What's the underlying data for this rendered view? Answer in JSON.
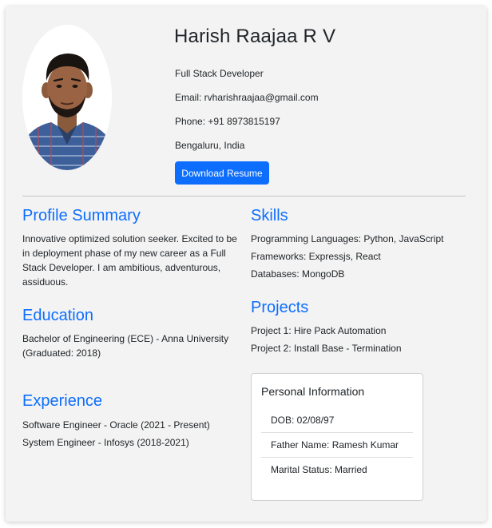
{
  "header": {
    "name": "Harish Raajaa R V",
    "role": "Full Stack Developer",
    "email": "Email: rvharishraajaa@gmail.com",
    "phone": "Phone: +91 8973815197",
    "location": "Bengaluru, India",
    "download_label": "Download Resume"
  },
  "profile_summary": {
    "title": "Profile Summary",
    "text": "Innovative optimized solution seeker. Excited to be in deployment phase of my new career as a Full Stack Developer. I am ambitious, adventurous, assiduous."
  },
  "education": {
    "title": "Education",
    "text": "Bachelor of Engineering (ECE) - Anna University (Graduated: 2018)"
  },
  "experience": {
    "title": "Experience",
    "items": [
      "Software Engineer - Oracle (2021 - Present)",
      "System Engineer - Infosys (2018-2021)"
    ]
  },
  "skills": {
    "title": "Skills",
    "items": [
      "Programming Languages: Python, JavaScript",
      "Frameworks: Expressjs, React",
      "Databases: MongoDB"
    ]
  },
  "projects": {
    "title": "Projects",
    "items": [
      "Project 1: Hire Pack Automation",
      "Project 2: Install Base - Termination"
    ]
  },
  "personal_information": {
    "title": "Personal Information",
    "items": [
      "DOB: 02/08/97",
      "Father Name: Ramesh Kumar",
      "Marital Status: Married"
    ]
  },
  "colors": {
    "accent": "#0d6efd",
    "card_background": "#f3f3f3",
    "text": "#212529"
  }
}
